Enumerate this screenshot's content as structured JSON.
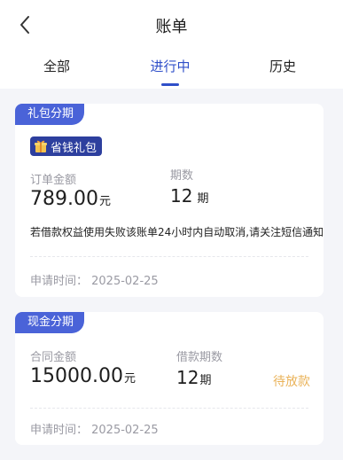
{
  "header": {
    "title": "账单",
    "back_icon": "chevron-left-icon"
  },
  "tabs": [
    {
      "label": "全部",
      "active": false
    },
    {
      "label": "进行中",
      "active": true
    },
    {
      "label": "历史",
      "active": false
    }
  ],
  "colors": {
    "accent": "#2f4fc9",
    "tag_bg": "#4a63d8",
    "badge_bg": "#2d3f9e",
    "pending": "#eab35a",
    "background": "#f4f5f9"
  },
  "bills": [
    {
      "tag": "礼包分期",
      "badge": {
        "icon": "gift-icon",
        "label": "省钱礼包"
      },
      "amount_label": "订单金额",
      "amount": "789.00",
      "amount_unit": "元",
      "period_label": "期数",
      "period": "12",
      "period_unit": "期",
      "notice": "若借款权益使用失败该账单24小时内自动取消,请关注短信通知",
      "apply_time": "申请时间：  2025-02-25"
    },
    {
      "tag": "现金分期",
      "amount_label": "合同金额",
      "amount": "15000.00",
      "amount_unit": "元",
      "period_label": "借款期数",
      "period": "12",
      "period_unit": "期",
      "status": "待放款",
      "apply_time": "申请时间：  2025-02-25"
    }
  ]
}
